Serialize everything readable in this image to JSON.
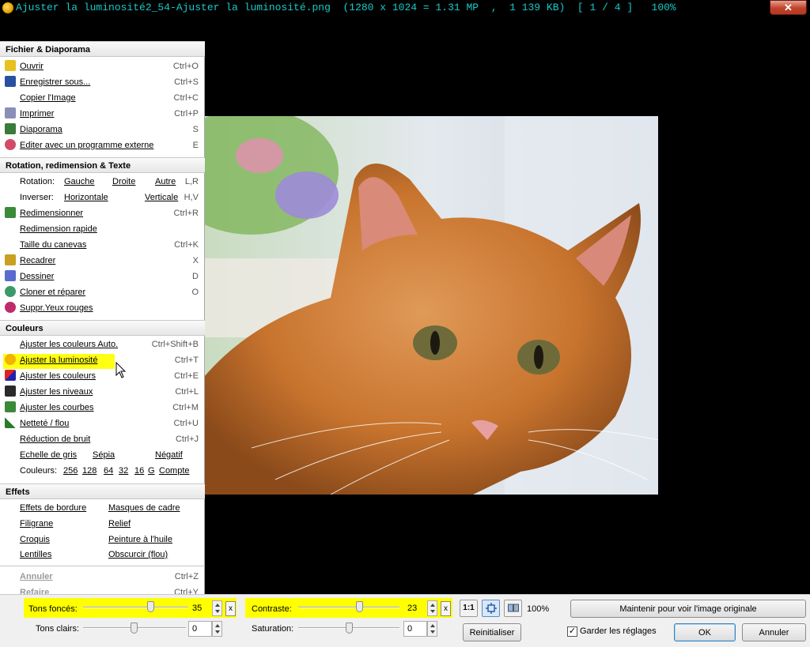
{
  "window": {
    "title": "Ajuster la luminosité2_54-Ajuster la luminosité.png  (1280 x 1024 = 1.31 MP  ,  1 139 KB)  [ 1 / 4 ]   100%",
    "close": "✕"
  },
  "menu": {
    "file": {
      "header": "Fichier & Diaporama",
      "items": [
        {
          "label": "Ouvrir",
          "shortcut": "Ctrl+O"
        },
        {
          "label": "Enregistrer sous...",
          "shortcut": "Ctrl+S"
        },
        {
          "label": "Copier l'Image",
          "shortcut": "Ctrl+C"
        },
        {
          "label": "Imprimer",
          "shortcut": "Ctrl+P"
        },
        {
          "label": "Diaporama",
          "shortcut": "S"
        },
        {
          "label": "Editer avec un programme externe",
          "shortcut": "E"
        }
      ]
    },
    "rotation": {
      "header": "Rotation, redimension & Texte",
      "rotation_label": "Rotation:",
      "gauche": "Gauche",
      "droite": "Droite",
      "autre": "Autre",
      "rotation_shortcut": "L,R",
      "inverser_label": "Inverser:",
      "horizontale": "Horizontale",
      "verticale": "Verticale",
      "inverser_shortcut": "H,V",
      "items": [
        {
          "label": "Redimensionner",
          "shortcut": "Ctrl+R"
        },
        {
          "label": "Redimension rapide",
          "shortcut": ""
        },
        {
          "label": "Taille du canevas",
          "shortcut": "Ctrl+K"
        },
        {
          "label": "Recadrer",
          "shortcut": "X"
        },
        {
          "label": "Dessiner",
          "shortcut": "D"
        },
        {
          "label": "Cloner et réparer",
          "shortcut": "O"
        },
        {
          "label": "Suppr.Yeux rouges",
          "shortcut": ""
        }
      ]
    },
    "couleurs": {
      "header": "Couleurs",
      "items": [
        {
          "label": "Ajuster les couleurs Auto.",
          "shortcut": "Ctrl+Shift+B"
        },
        {
          "label": "Ajuster la luminosité",
          "shortcut": "Ctrl+T"
        },
        {
          "label": "Ajuster les couleurs",
          "shortcut": "Ctrl+E"
        },
        {
          "label": "Ajuster les niveaux",
          "shortcut": "Ctrl+L"
        },
        {
          "label": "Ajuster les courbes",
          "shortcut": "Ctrl+M"
        },
        {
          "label": "Netteté / flou",
          "shortcut": "Ctrl+U"
        },
        {
          "label": "Réduction de bruit",
          "shortcut": "Ctrl+J"
        }
      ],
      "echelle": "Echelle de gris",
      "sepia": "Sépia",
      "negatif": "Négatif",
      "couleurs_label": "Couleurs:",
      "couleurs_opts": [
        "256",
        "128",
        "64",
        "32",
        "16",
        "G",
        "Compte"
      ]
    },
    "effets": {
      "header": "Effets",
      "items": [
        [
          "Effets de bordure",
          "Masques de cadre"
        ],
        [
          "Filigrane",
          "Relief"
        ],
        [
          "Croquis",
          "Peinture à l'huile"
        ],
        [
          "Lentilles",
          "Obscurcir (flou)"
        ]
      ]
    },
    "edit": {
      "annuler": "Annuler",
      "annuler_sc": "Ctrl+Z",
      "refaire": "Refaire",
      "refaire_sc": "Ctrl+Y"
    }
  },
  "controls": {
    "tons_fonces": {
      "label": "Tons foncés:",
      "value": "35",
      "reset": "x"
    },
    "contraste": {
      "label": "Contraste:",
      "value": "23",
      "reset": "x"
    },
    "tons_clairs": {
      "label": "Tons clairs:",
      "value": "0"
    },
    "saturation": {
      "label": "Saturation:",
      "value": "0"
    },
    "one_to_one": "1:1",
    "zoom": "100%",
    "maintain_btn": "Maintenir pour voir l'image originale",
    "reset_btn": "Reinitialiser",
    "keep_settings": "Garder les réglages",
    "ok": "OK",
    "cancel": "Annuler"
  },
  "colors": {
    "highlight": "#ffff00",
    "title": "#19c9c9"
  }
}
